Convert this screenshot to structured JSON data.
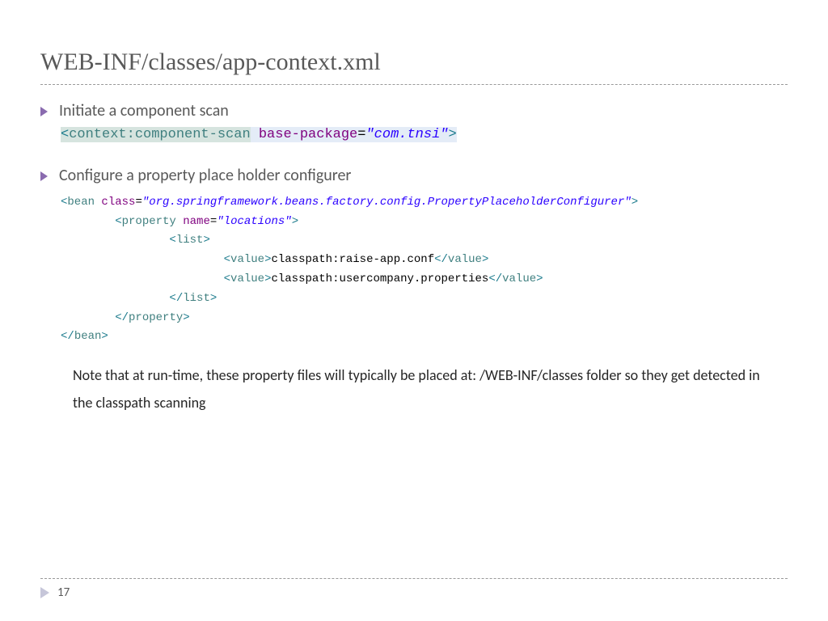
{
  "title": "WEB-INF/classes/app-context.xml",
  "bullets": {
    "b1": "Initiate a component scan",
    "b2": "Configure a property place holder configurer"
  },
  "code1": {
    "lt1": "<",
    "tag": "context:component-scan",
    "space": " ",
    "attr": "base-package",
    "eq": "=",
    "val": "\"com.tnsi\"",
    "gt": ">"
  },
  "code2": {
    "l1_open": "<",
    "l1_tag": "bean",
    "l1_sp": " ",
    "l1_attr": "class",
    "l1_eq": "=",
    "l1_val": "\"org.springframework.beans.factory.config.PropertyPlaceholderConfigurer\"",
    "l1_close": ">",
    "l2_indent": "        ",
    "l2_open": "<",
    "l2_tag": "property",
    "l2_sp": " ",
    "l2_attr": "name",
    "l2_eq": "=",
    "l2_val": "\"locations\"",
    "l2_close": ">",
    "l3_indent": "                ",
    "l3_open": "<",
    "l3_tag": "list",
    "l3_close": ">",
    "l4_indent": "                        ",
    "l4_open": "<",
    "l4_tag": "value",
    "l4_close": ">",
    "l4_text": "classpath:raise-app.conf",
    "l4_open2": "</",
    "l4_tag2": "value",
    "l4_close2": ">",
    "l5_indent": "                        ",
    "l5_open": "<",
    "l5_tag": "value",
    "l5_close": ">",
    "l5_text": "classpath:usercompany.properties",
    "l5_open2": "</",
    "l5_tag2": "value",
    "l5_close2": ">",
    "l6_indent": "                ",
    "l6_open": "</",
    "l6_tag": "list",
    "l6_close": ">",
    "l7_indent": "        ",
    "l7_open": "</",
    "l7_tag": "property",
    "l7_close": ">",
    "l8_open": "</",
    "l8_tag": "bean",
    "l8_close": ">"
  },
  "note": "Note that at run-time, these property files will typically be placed at: /WEB-INF/classes folder so they get detected in the classpath scanning",
  "page": "17"
}
